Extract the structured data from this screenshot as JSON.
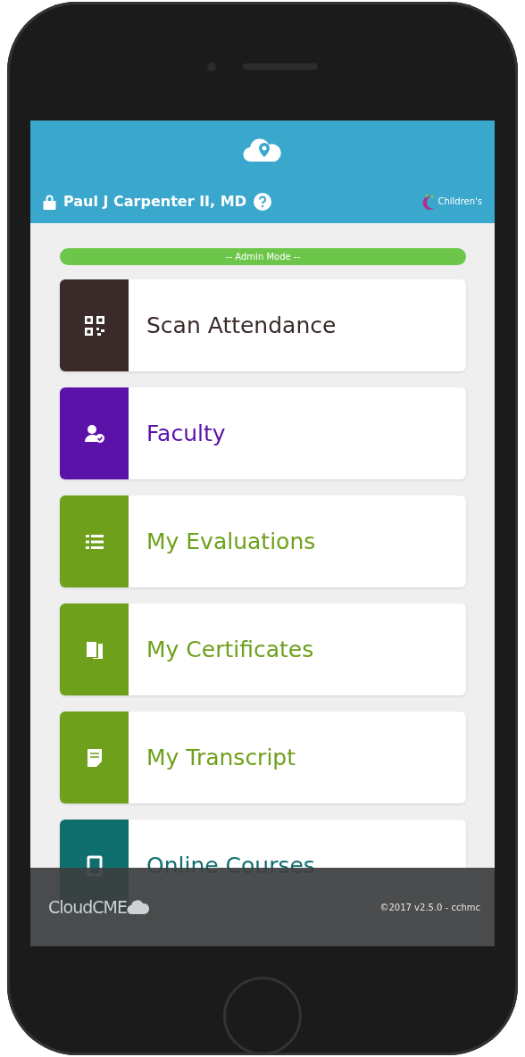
{
  "header": {
    "user_name": "Paul J Carpenter II, MD",
    "logo_text": "Children's"
  },
  "admin_banner": "-- Admin Mode --",
  "menu_items": [
    {
      "label": "Scan Attendance",
      "kind": "qr",
      "color": "#3a2a2a"
    },
    {
      "label": "Faculty",
      "kind": "faculty",
      "color": "#5a12a8"
    },
    {
      "label": "My Evaluations",
      "kind": "list",
      "color": "#6ea01c"
    },
    {
      "label": "My Certificates",
      "kind": "certificates",
      "color": "#6ea01c"
    },
    {
      "label": "My Transcript",
      "kind": "transcript",
      "color": "#6ea01c"
    },
    {
      "label": "Online Courses",
      "kind": "tablet",
      "color": "#0f6e6e"
    }
  ],
  "footer": {
    "brand": "CloudCME",
    "version": "©2017 v2.5.0 - cchmc"
  }
}
